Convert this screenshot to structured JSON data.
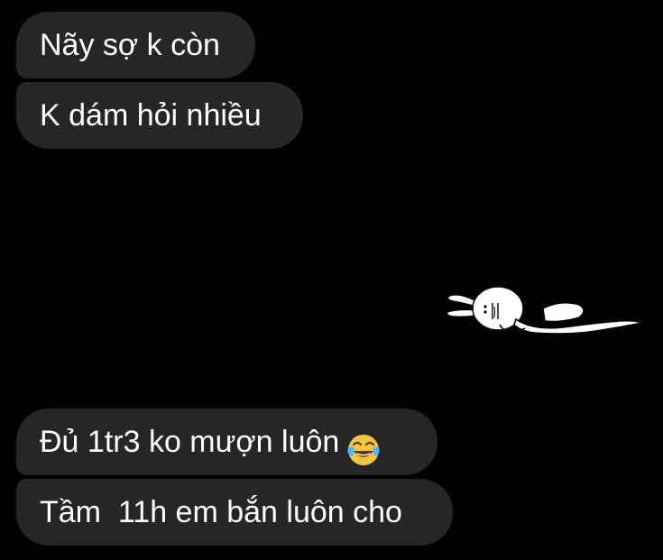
{
  "messages": [
    {
      "text": "Nãy sợ k còn"
    },
    {
      "text": "K dám hỏi nhiều"
    },
    {
      "text": "Đủ 1tr3 ko mượn luôn",
      "emoji": "face-with-tears-of-joy-icon"
    },
    {
      "text": "Tầm  11h em bắn luôn cho"
    }
  ],
  "sticker": {
    "icon": "lying-rabbit-sticker-icon"
  },
  "colors": {
    "background": "#000000",
    "bubble": "#262628",
    "text": "#ffffff"
  }
}
